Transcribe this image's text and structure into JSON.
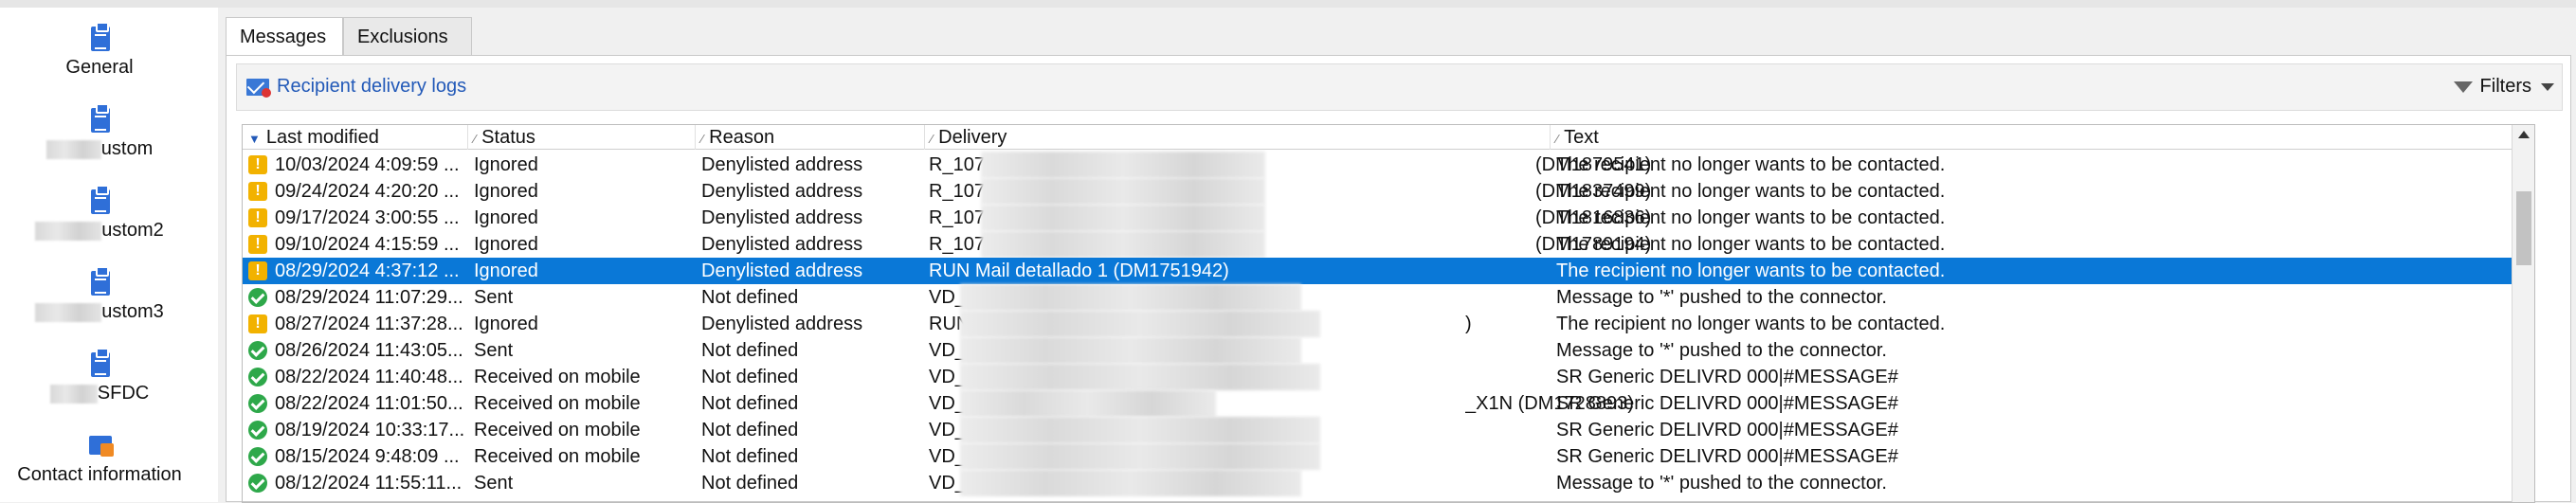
{
  "sidebar": {
    "items": [
      {
        "label": "General",
        "icon": "clipboard-icon"
      },
      {
        "label": "ustom",
        "icon": "clipboard-icon"
      },
      {
        "label": "ustom2",
        "icon": "clipboard-icon"
      },
      {
        "label": "ustom3",
        "icon": "clipboard-icon"
      },
      {
        "label": "SFDC",
        "icon": "clipboard-icon"
      },
      {
        "label": "Contact information",
        "icon": "contact-card-icon"
      }
    ]
  },
  "tabs": [
    {
      "label": "Messages",
      "active": true
    },
    {
      "label": "Exclusions",
      "active": false
    }
  ],
  "toolbar": {
    "title": "Recipient delivery logs",
    "filters_label": "Filters"
  },
  "table": {
    "columns": [
      "Last modified",
      "Status",
      "Reason",
      "Delivery",
      "Text"
    ],
    "rows": [
      {
        "icon": "warning",
        "modified": "10/03/2024 4:09:59 ...",
        "status": "Ignored",
        "reason": "Denylisted address",
        "delivery_prefix": "R_107",
        "delivery_suffix": "(DM1879541)",
        "text": "The recipient no longer wants to be contacted."
      },
      {
        "icon": "warning",
        "modified": "09/24/2024 4:20:20 ...",
        "status": "Ignored",
        "reason": "Denylisted address",
        "delivery_prefix": "R_107",
        "delivery_suffix": "(DM1837499)",
        "text": "The recipient no longer wants to be contacted."
      },
      {
        "icon": "warning",
        "modified": "09/17/2024 3:00:55 ...",
        "status": "Ignored",
        "reason": "Denylisted address",
        "delivery_prefix": "R_107",
        "delivery_suffix": "(DM1816836)",
        "text": "The recipient no longer wants to be contacted."
      },
      {
        "icon": "warning",
        "modified": "09/10/2024 4:15:59 ...",
        "status": "Ignored",
        "reason": "Denylisted address",
        "delivery_prefix": "R_107",
        "delivery_suffix": "(DM1789194)",
        "text": "The recipient no longer wants to be contacted."
      },
      {
        "icon": "warning",
        "modified": "08/29/2024 4:37:12 ...",
        "status": "Ignored",
        "reason": "Denylisted address",
        "delivery_prefix": "RUN Mail detallado 1 (DM1751942)",
        "delivery_suffix": "",
        "text": "The recipient no longer wants to be contacted.",
        "selected": true
      },
      {
        "icon": "ok",
        "modified": "08/29/2024 11:07:29...",
        "status": "Sent",
        "reason": "Not defined",
        "delivery_prefix": "VD_",
        "delivery_suffix": "",
        "text": "Message to '*' pushed to the connector."
      },
      {
        "icon": "warning",
        "modified": "08/27/2024 11:37:28...",
        "status": "Ignored",
        "reason": "Denylisted address",
        "delivery_prefix": "RUN",
        "delivery_suffix": ")",
        "text": "The recipient no longer wants to be contacted."
      },
      {
        "icon": "ok",
        "modified": "08/26/2024 11:43:05...",
        "status": "Sent",
        "reason": "Not defined",
        "delivery_prefix": "VD_",
        "delivery_suffix": "",
        "text": "Message to '*' pushed to the connector."
      },
      {
        "icon": "ok",
        "modified": "08/22/2024 11:40:48...",
        "status": "Received on mobile",
        "reason": "Not defined",
        "delivery_prefix": "VD_",
        "delivery_suffix": "",
        "text": "SR Generic DELIVRD 000|#MESSAGE#"
      },
      {
        "icon": "ok",
        "modified": "08/22/2024 11:01:50...",
        "status": "Received on mobile",
        "reason": "Not defined",
        "delivery_prefix": "VD_",
        "delivery_suffix": "_X1N (DM1728893)",
        "text": "SR Generic DELIVRD 000|#MESSAGE#"
      },
      {
        "icon": "ok",
        "modified": "08/19/2024 10:33:17...",
        "status": "Received on mobile",
        "reason": "Not defined",
        "delivery_prefix": "VD_",
        "delivery_suffix": "",
        "text": "SR Generic DELIVRD 000|#MESSAGE#"
      },
      {
        "icon": "ok",
        "modified": "08/15/2024 9:48:09 ...",
        "status": "Received on mobile",
        "reason": "Not defined",
        "delivery_prefix": "VD_",
        "delivery_suffix": "",
        "text": "SR Generic DELIVRD 000|#MESSAGE#"
      },
      {
        "icon": "ok",
        "modified": "08/12/2024 11:55:11...",
        "status": "Sent",
        "reason": "Not defined",
        "delivery_prefix": "VD_",
        "delivery_suffix": "",
        "text": "Message to '*' pushed to the connector."
      }
    ]
  },
  "colors": {
    "selection": "#0a78d7",
    "link": "#2259b8",
    "warning": "#f2b200",
    "ok": "#2ea84a"
  }
}
